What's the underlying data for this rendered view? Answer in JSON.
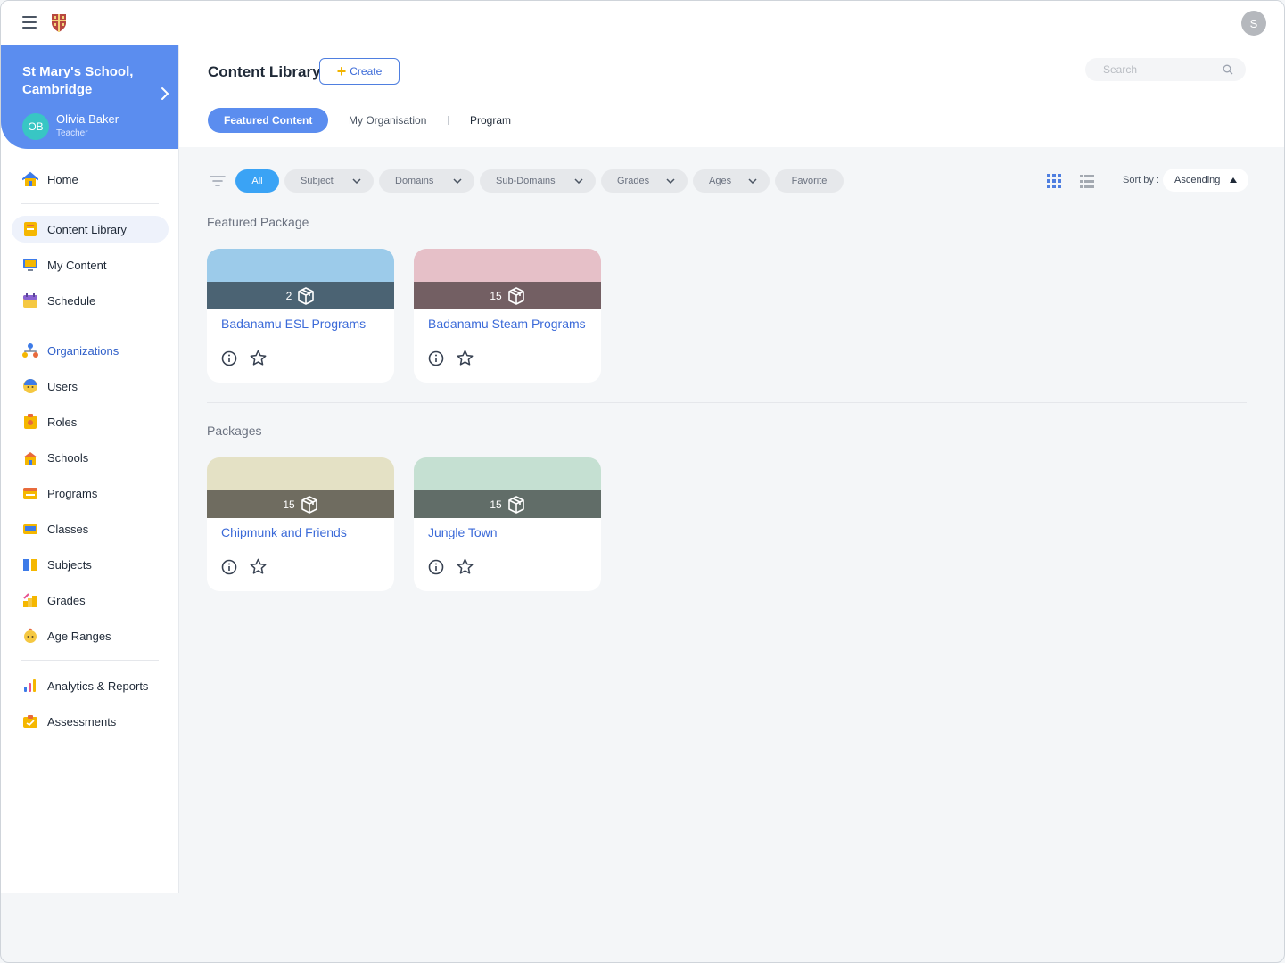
{
  "topbar": {
    "user_initial": "S"
  },
  "sidebar": {
    "org_name": "St Mary's School, Cambridge",
    "user_initials": "OB",
    "user_name": "Olivia Baker",
    "user_role": "Teacher",
    "items": [
      {
        "label": "Home",
        "icon": "home-icon"
      },
      {
        "label": "Content Library",
        "icon": "book-icon"
      },
      {
        "label": "My Content",
        "icon": "monitor-icon"
      },
      {
        "label": "Schedule",
        "icon": "calendar-icon"
      },
      {
        "label": "Organizations",
        "icon": "org-chart-icon"
      },
      {
        "label": "Users",
        "icon": "user-icon"
      },
      {
        "label": "Roles",
        "icon": "role-icon"
      },
      {
        "label": "Schools",
        "icon": "school-icon"
      },
      {
        "label": "Programs",
        "icon": "program-icon"
      },
      {
        "label": "Classes",
        "icon": "classes-icon"
      },
      {
        "label": "Subjects",
        "icon": "subjects-icon"
      },
      {
        "label": "Grades",
        "icon": "grades-icon"
      },
      {
        "label": "Age Ranges",
        "icon": "age-icon"
      },
      {
        "label": "Analytics & Reports",
        "icon": "analytics-icon"
      },
      {
        "label": "Assessments",
        "icon": "assessments-icon"
      }
    ]
  },
  "header": {
    "title": "Content Library",
    "create_label": "Create",
    "search_placeholder": "Search",
    "tabs": [
      "Featured Content",
      "My Organisation",
      "Program"
    ]
  },
  "filters": {
    "chips": [
      "All",
      "Subject",
      "Domains",
      "Sub-Domains",
      "Grades",
      "Ages",
      "Favorite"
    ],
    "sort_label": "Sort by :",
    "sort_value": "Ascending"
  },
  "sections": [
    {
      "title": "Featured Package",
      "cards": [
        {
          "count": "2",
          "title": "Badanamu ESL Programs",
          "top_color": "#9ccbea",
          "band_color": "#4b6373"
        },
        {
          "count": "15",
          "title": "Badanamu Steam Programs",
          "top_color": "#e6c0c8",
          "band_color": "#735f63"
        }
      ]
    },
    {
      "title": "Packages",
      "cards": [
        {
          "count": "15",
          "title": "Chipmunk and Friends",
          "top_color": "#e4e1c5",
          "band_color": "#6f6c60"
        },
        {
          "count": "15",
          "title": "Jungle Town",
          "top_color": "#c5e0d2",
          "band_color": "#616d68"
        }
      ]
    }
  ]
}
